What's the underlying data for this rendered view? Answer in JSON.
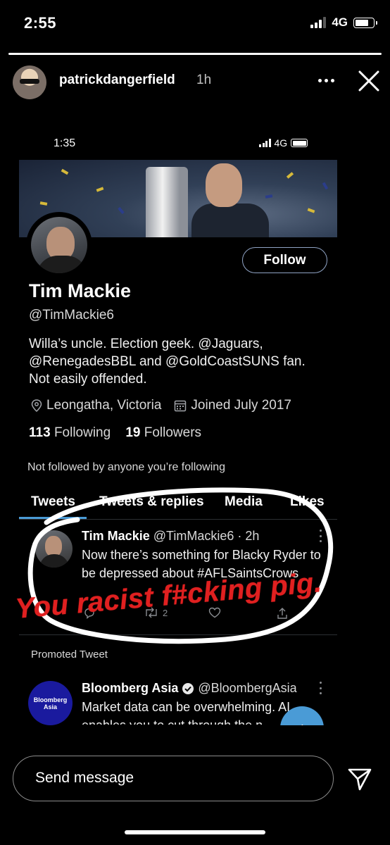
{
  "status_bar": {
    "time": "2:55",
    "network": "4G",
    "signal_bars": 3
  },
  "story": {
    "progress": 1.0,
    "username": "patrickdangerfield",
    "time_ago": "1h",
    "more_icon": "ellipsis-icon",
    "close_icon": "close-icon"
  },
  "screenshot": {
    "status_bar": {
      "time": "1:35",
      "network": "4G"
    },
    "profile": {
      "follow_label": "Follow",
      "name": "Tim Mackie",
      "handle": "@TimMackie6",
      "bio": "Willa’s uncle. Election geek. @Jaguars, @RenegadesBBL and @GoldCoastSUNS fan. Not easily offended.",
      "location": "Leongatha, Victoria",
      "joined": "Joined July 2017",
      "following_count": "113",
      "following_label": "Following",
      "followers_count": "19",
      "followers_label": "Followers",
      "not_followed": "Not followed by anyone you’re following"
    },
    "tabs": [
      "Tweets",
      "Tweets & replies",
      "Media",
      "Likes"
    ],
    "active_tab": "Tweets",
    "tweet": {
      "name": "Tim Mackie",
      "handle_time": "@TimMackie6 · 2h",
      "text": "Now there’s something for Blacky Ryder to be depressed about #AFLSaintsCrows",
      "retweet_count": "2"
    },
    "promoted_label": "Promoted Tweet",
    "promoted_tweet": {
      "avatar_text": [
        "Bloomberg",
        "Asia"
      ],
      "name": "Bloomberg Asia",
      "handle": "@BloombergAsia",
      "text": "Market data can be overwhelming. AI enables you to cut through the n..."
    }
  },
  "annotation": {
    "text": "You racist f#cking pig.",
    "color": "#e02020"
  },
  "bottom": {
    "send_placeholder": "Send message",
    "send_icon": "paper-plane-icon"
  },
  "colors": {
    "accent": "#4a9bd6",
    "background": "#000000"
  }
}
